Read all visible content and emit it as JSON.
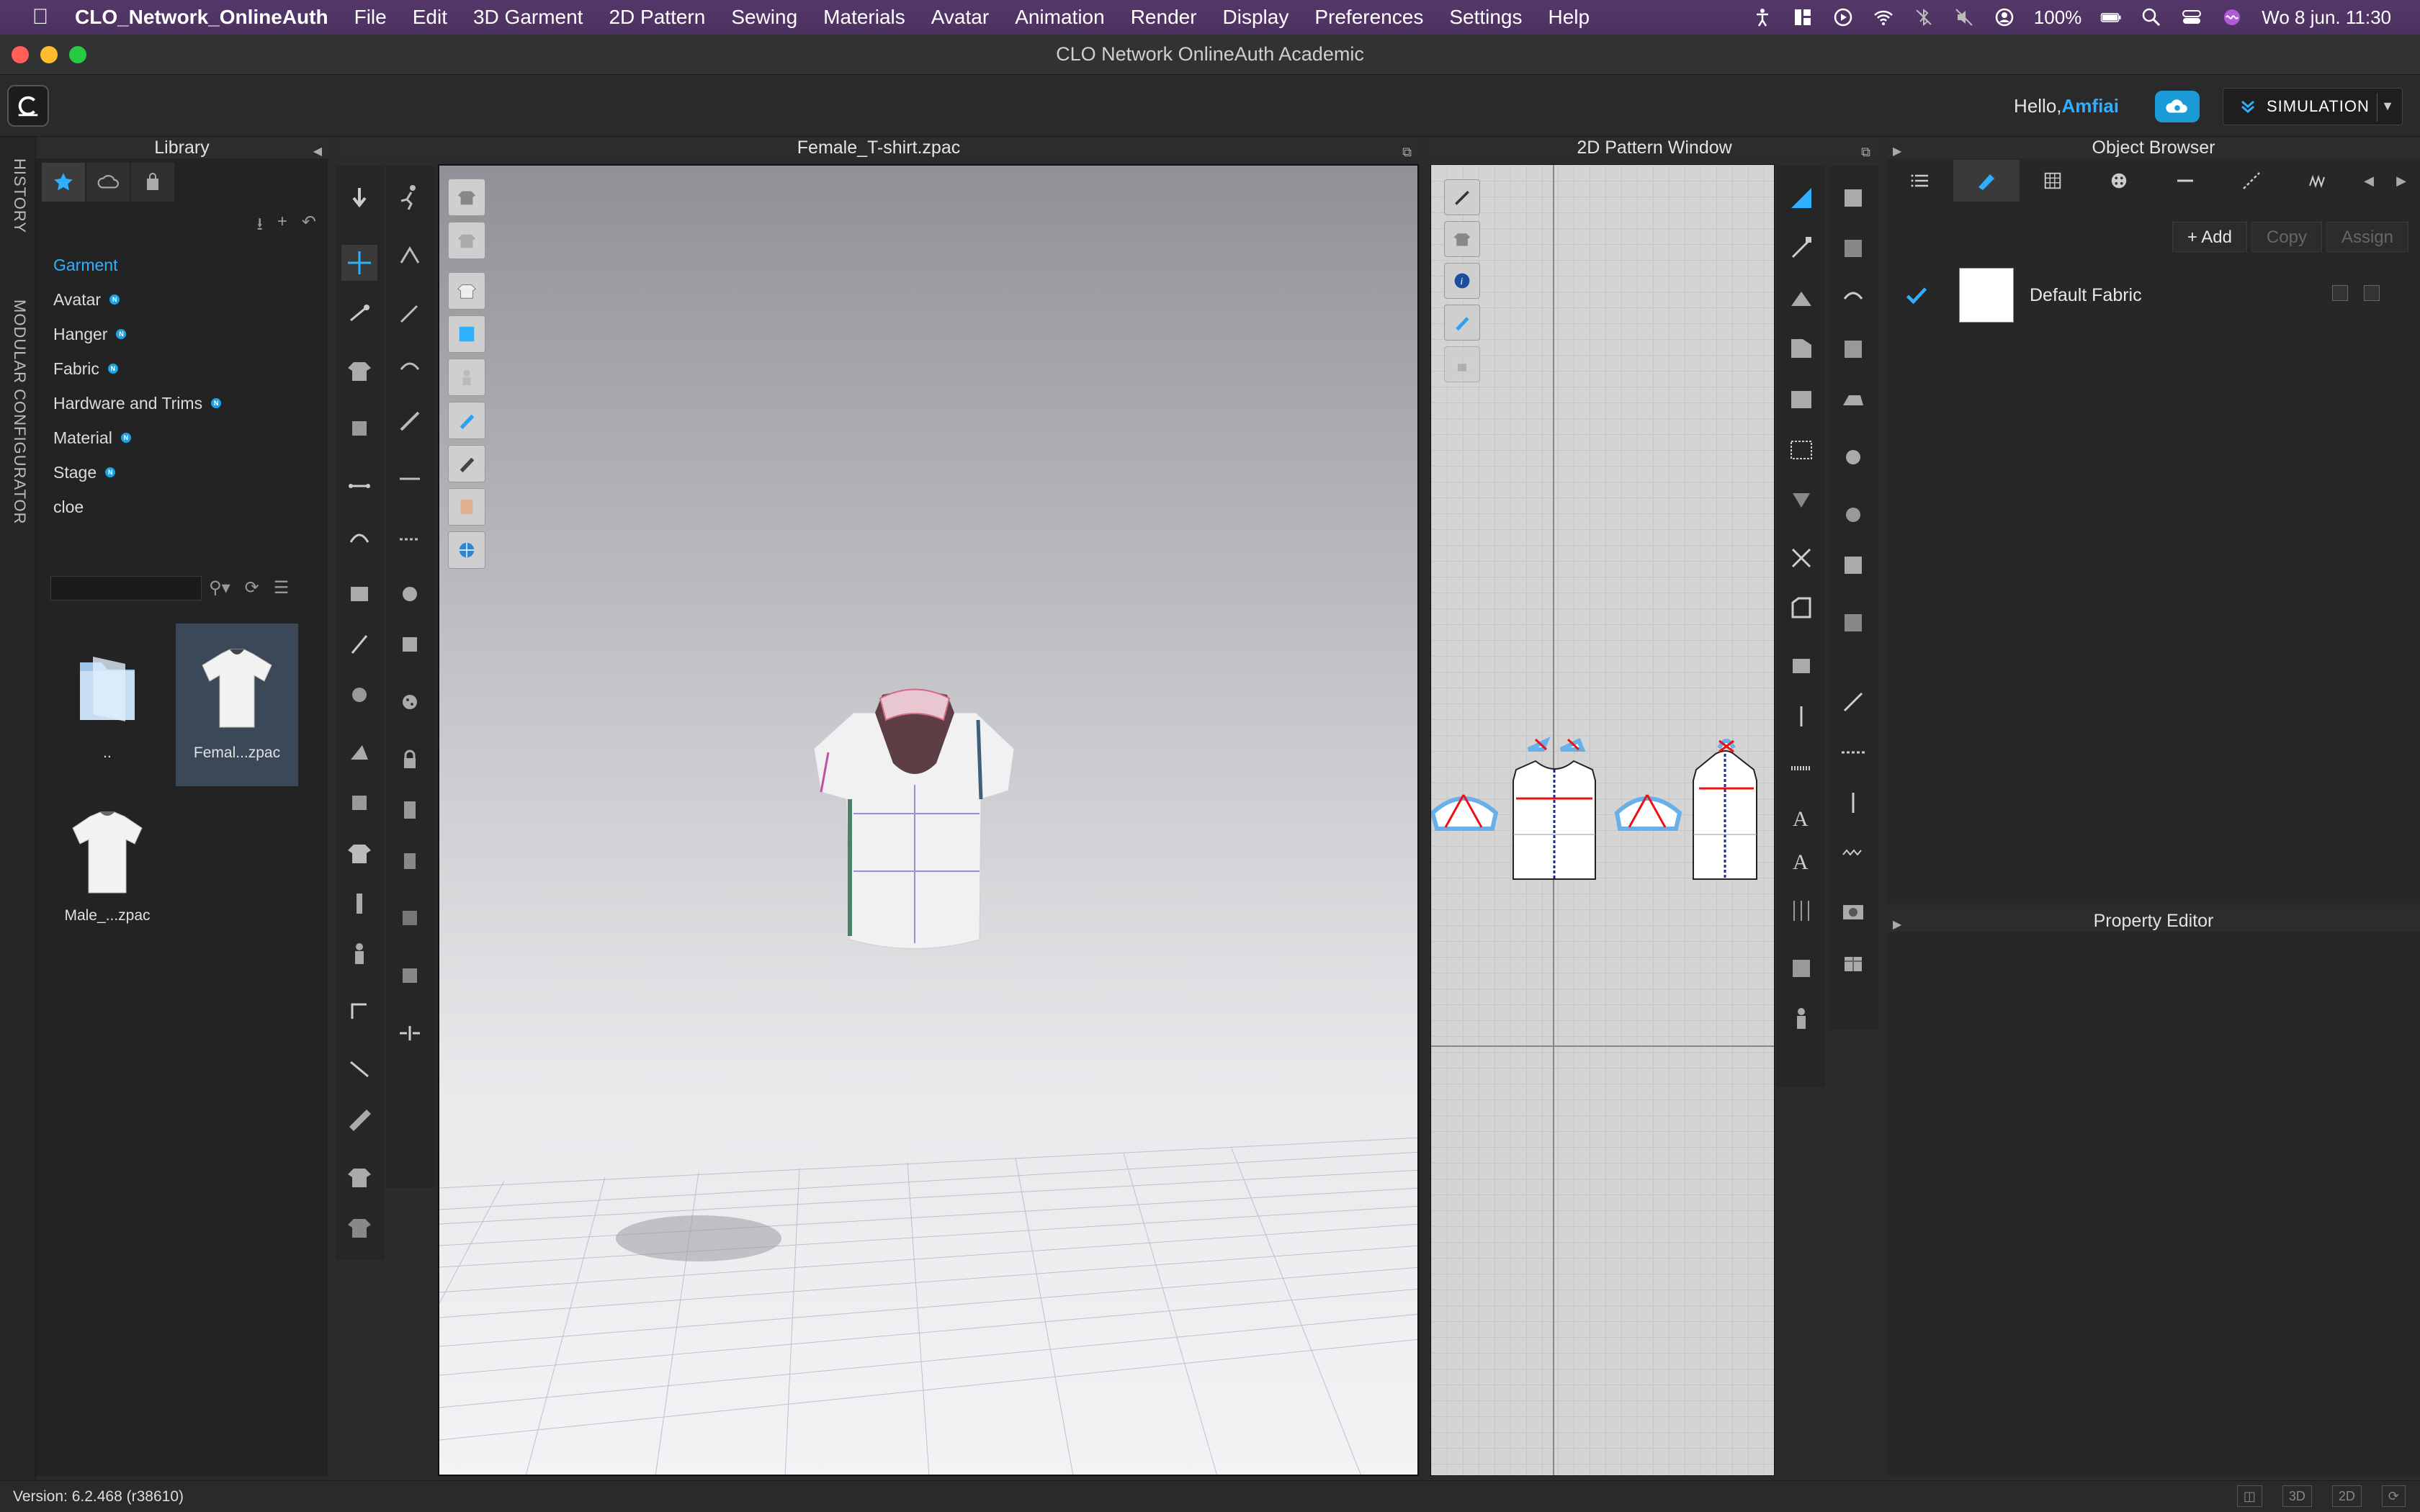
{
  "menubar": {
    "app_name": "CLO_Network_OnlineAuth",
    "items": [
      "File",
      "Edit",
      "3D Garment",
      "2D Pattern",
      "Sewing",
      "Materials",
      "Avatar",
      "Animation",
      "Render",
      "Display",
      "Preferences",
      "Settings",
      "Help"
    ],
    "battery": "100%",
    "clock": "Wo 8 jun.  11:30"
  },
  "window": {
    "title": "CLO Network OnlineAuth Academic"
  },
  "appbar": {
    "greeting": "Hello,",
    "username": "Amfiai",
    "mode_button": "SIMULATION"
  },
  "sidetabs": {
    "history": "HISTORY",
    "modular": "MODULAR CONFIGURATOR"
  },
  "library": {
    "title": "Library",
    "categories": [
      {
        "label": "Garment",
        "new": false,
        "active": true
      },
      {
        "label": "Avatar",
        "new": true
      },
      {
        "label": "Hanger",
        "new": true
      },
      {
        "label": "Fabric",
        "new": true
      },
      {
        "label": "Hardware and Trims",
        "new": true
      },
      {
        "label": "Material",
        "new": true
      },
      {
        "label": "Stage",
        "new": true
      },
      {
        "label": "cloe",
        "new": false
      }
    ],
    "new_badge": "N",
    "search_placeholder": "",
    "files": [
      {
        "label": "..",
        "type": "folder"
      },
      {
        "label": "Femal...zpac",
        "type": "garment",
        "selected": true
      },
      {
        "label": "Male_...zpac",
        "type": "garment"
      }
    ]
  },
  "view3d": {
    "title": "Female_T-shirt.zpac"
  },
  "view2d": {
    "title": "2D Pattern Window"
  },
  "object_browser": {
    "title": "Object Browser",
    "add": "+ Add",
    "copy": "Copy",
    "assign": "Assign",
    "fabric_name": "Default Fabric"
  },
  "property_editor": {
    "title": "Property Editor"
  },
  "status": {
    "version": "Version: 6.2.468 (r38610)",
    "view_3d": "3D",
    "view_2d": "2D"
  },
  "colors": {
    "accent": "#2fb0ff",
    "menubar": "#4b3160",
    "panel": "#232323"
  }
}
